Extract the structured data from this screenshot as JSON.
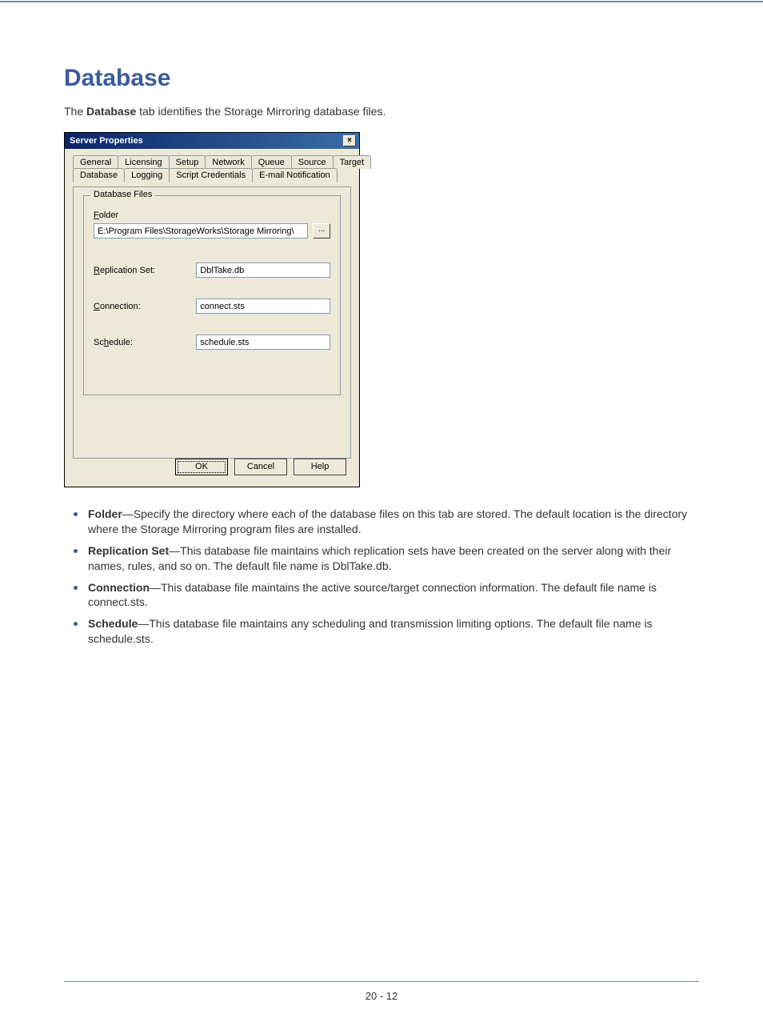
{
  "page": {
    "title": "Database",
    "intro_pre": "The ",
    "intro_bold": "Database",
    "intro_post": " tab identifies the Storage Mirroring database files.",
    "footer": "20 - 12"
  },
  "dialog": {
    "title": "Server Properties",
    "close": "×",
    "tabs_row1": [
      "General",
      "Licensing",
      "Setup",
      "Network",
      "Queue",
      "Source",
      "Target"
    ],
    "tabs_row2": [
      "Database",
      "Logging",
      "Script Credentials",
      "E-mail Notification"
    ],
    "active_tab": "Database",
    "fieldset_legend": "Database Files",
    "folder_label": "Folder",
    "folder_value": "E:\\Program Files\\StorageWorks\\Storage Mirroring\\",
    "browse": "...",
    "fields": {
      "repset_label": "Replication Set:",
      "repset_value": "DblTake.db",
      "conn_label": "Connection:",
      "conn_value": "connect.sts",
      "sched_label": "Schedule:",
      "sched_value": "schedule.sts"
    },
    "buttons": {
      "ok": "OK",
      "cancel": "Cancel",
      "help": "Help"
    }
  },
  "bullets": [
    {
      "term": "Folder",
      "text": "—Specify the directory where each of the database files on this tab are stored. The default location is the directory where the Storage Mirroring program files are installed."
    },
    {
      "term": "Replication Set",
      "text": "—This database file maintains which replication sets have been created on the server along with their names, rules, and so on. The default file name is DblTake.db."
    },
    {
      "term": "Connection",
      "text": "—This database file maintains the active source/target connection information. The default file name is connect.sts."
    },
    {
      "term": "Schedule",
      "text": "—This database file maintains any scheduling and transmission limiting options. The default file name is schedule.sts."
    }
  ]
}
